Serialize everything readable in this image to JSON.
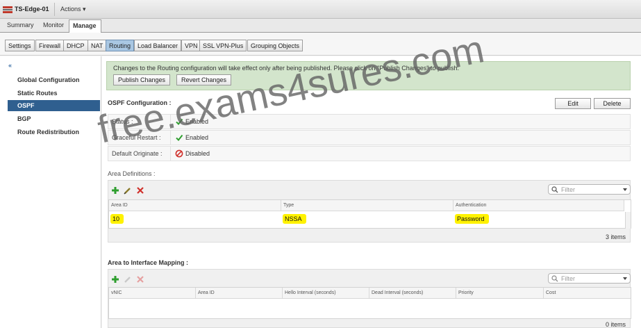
{
  "header": {
    "title": "TS-Edge-01",
    "actions_label": "Actions ▾"
  },
  "top_tabs": [
    {
      "label": "Summary"
    },
    {
      "label": "Monitor"
    },
    {
      "label": "Manage",
      "active": true
    }
  ],
  "sub_tabs": [
    {
      "label": "Settings"
    },
    {
      "label": "Firewall"
    },
    {
      "label": "DHCP"
    },
    {
      "label": "NAT"
    },
    {
      "label": "Routing",
      "active": true
    },
    {
      "label": "Load Balancer"
    },
    {
      "label": "VPN"
    },
    {
      "label": "SSL VPN-Plus"
    },
    {
      "label": "Grouping Objects"
    }
  ],
  "sidebar": {
    "collapse_glyph": "«",
    "items": [
      {
        "label": "Global Configuration"
      },
      {
        "label": "Static Routes"
      },
      {
        "label": "OSPF",
        "active": true
      },
      {
        "label": "BGP"
      },
      {
        "label": "Route Redistribution"
      }
    ]
  },
  "notice": {
    "text": "Changes to the Routing configuration will take effect only after being published. Please click on \"Publish Changes\" to publish.",
    "publish_label": "Publish Changes",
    "revert_label": "Revert Changes"
  },
  "ospf_config": {
    "title": "OSPF Configuration :",
    "edit_label": "Edit",
    "delete_label": "Delete",
    "rows": [
      {
        "label": "Status :",
        "value": "Enabled",
        "icon": "check-icon"
      },
      {
        "label": "Graceful Restart :",
        "value": "Enabled",
        "icon": "check-icon"
      },
      {
        "label": "Default Originate :",
        "value": "Disabled",
        "icon": "disabled-icon"
      }
    ]
  },
  "area_definitions": {
    "title": "Area Definitions :",
    "filter_placeholder": "Filter",
    "columns": [
      "Area ID",
      "Type",
      "Authentication"
    ],
    "rows": [
      {
        "area_id": "10",
        "type": "NSSA",
        "auth": "Password"
      }
    ],
    "count": "3 items"
  },
  "area_interface_mapping": {
    "title": "Area to Interface Mapping :",
    "filter_placeholder": "Filter",
    "columns": [
      "vNIC",
      "Area ID",
      "Hello Interval (seconds)",
      "Dead Interval (seconds)",
      "Priority",
      "Cost"
    ],
    "count": "0 items"
  },
  "watermark": "free.exams4sures.com",
  "colors": {
    "accent": "#2f5f8f",
    "notice_bg": "#d3e5cc",
    "highlight": "#fff200",
    "active_tab": "#a9c7e3"
  }
}
